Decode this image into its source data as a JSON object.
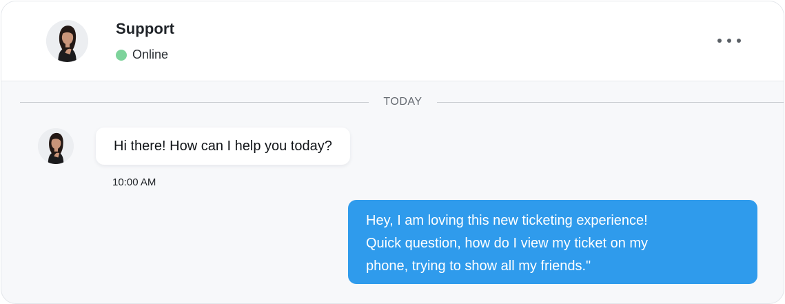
{
  "header": {
    "contact_name": "Support",
    "status": "Online",
    "status_color": "#7dd39b",
    "avatar_icon": "support-agent-avatar",
    "more_icon": "more-horizontal-icon"
  },
  "conversation": {
    "date_divider": "TODAY",
    "messages": [
      {
        "direction": "incoming",
        "text": "Hi there! How can I help you today?",
        "time": "10:00 AM"
      },
      {
        "direction": "outgoing",
        "text": "Hey, I am loving this new ticketing experience!\nQuick question, how do I view my ticket on my\nphone, trying to show all my friends.\"",
        "bubble_color": "#2f9bec"
      }
    ]
  }
}
